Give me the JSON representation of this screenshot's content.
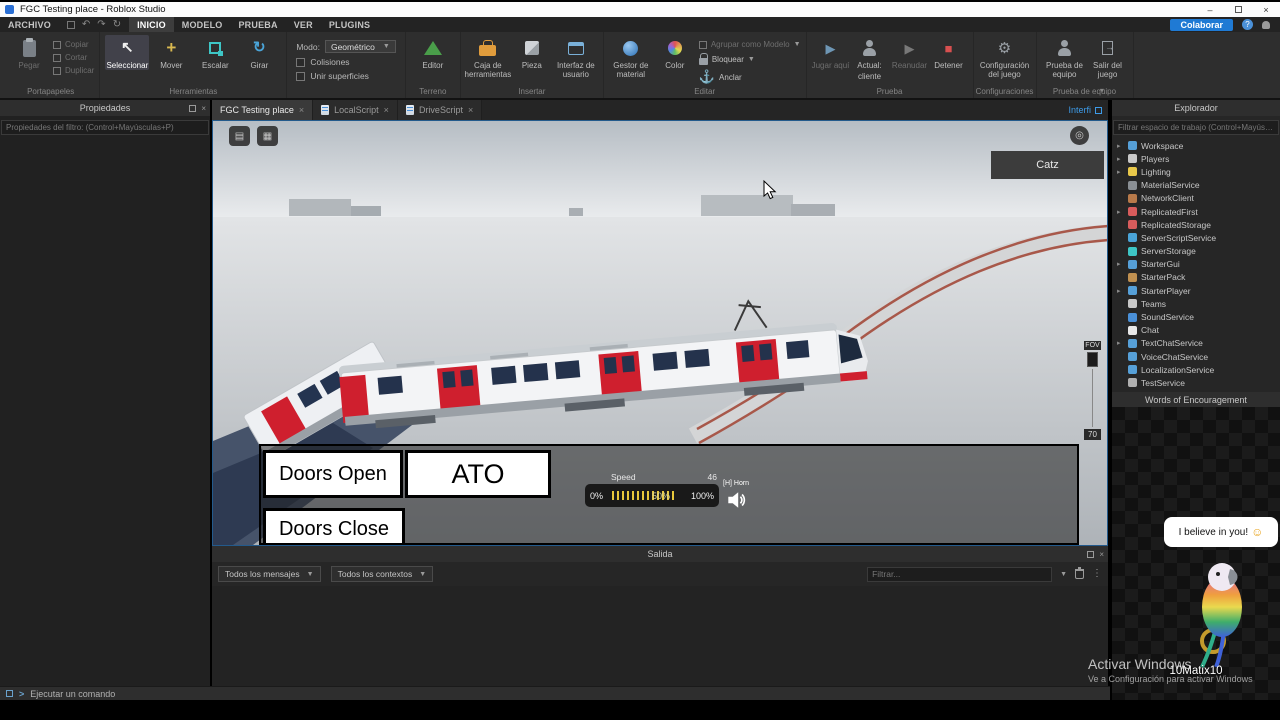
{
  "title_bar": {
    "title": "FGC Testing place - Roblox Studio",
    "minimize": "–",
    "close": "×"
  },
  "menu_bar": {
    "items": [
      "ARCHIVO",
      "INICIO",
      "MODELO",
      "PRUEBA",
      "VER",
      "PLUGINS"
    ],
    "active_item": "INICIO",
    "collaborate_label": "Colaborar",
    "help_glyph": "?"
  },
  "ribbon": {
    "clipboard": {
      "label": "Portapapeles",
      "paste": "Pegar",
      "copy": "Copiar",
      "cut": "Cortar",
      "duplicate": "Duplicar"
    },
    "tools": {
      "label": "Herramientas",
      "select": "Seleccionar",
      "move": "Mover",
      "scale": "Escalar",
      "rotate": "Girar",
      "mode_label": "Modo:",
      "mode_value": "Geométrico",
      "collisions": "Colisiones",
      "join_surfaces": "Unir superficies"
    },
    "terrain": {
      "label": "Terreno",
      "editor": "Editor"
    },
    "insert": {
      "label": "Insertar",
      "toolbox": "Caja de herramientas",
      "part": "Pieza",
      "ui": "Interfaz de usuario"
    },
    "edit": {
      "label": "Editar",
      "material_manager": "Gestor de material",
      "color": "Color",
      "group_model": "Agrupar como Modelo",
      "lock": "Bloquear",
      "anchor": "Anclar"
    },
    "test": {
      "label": "Prueba",
      "play_here": "Jugar aquí",
      "current_line1": "Actual:",
      "current_line2": "cliente",
      "resume": "Reanudar",
      "stop": "Detener"
    },
    "settings": {
      "label": "Configuraciones",
      "game_settings": "Configuración del juego"
    },
    "team_test": {
      "label": "Prueba de equipo",
      "team_test": "Prueba de equipo",
      "exit_game": "Salir del juego"
    }
  },
  "properties": {
    "title": "Propiedades",
    "filter_placeholder": "Propiedades del filtro: (Control+Mayúsculas+P)"
  },
  "tabs": {
    "items": [
      "FGC Testing place",
      "LocalScript",
      "DriveScript"
    ],
    "corner_link": "Interfi"
  },
  "viewport": {
    "catz_button": "Catz",
    "fov_label": "FOV",
    "fov_value": "70",
    "hud": {
      "doors_open": "Doors Open",
      "ato": "ATO",
      "doors_close": "Doors Close",
      "speed_label": "Speed",
      "speed_value": "46",
      "pct_0": "0%",
      "pct_50": "50%",
      "pct_100": "100%",
      "horn_label": "[H] Horn",
      "tick_color": "#e8c83c"
    }
  },
  "explorer": {
    "title": "Explorador",
    "filter_placeholder": "Filtrar espacio de trabajo (Control+Mayúsculas+X)",
    "items": [
      {
        "label": "Workspace",
        "color": "#56a0d8",
        "chevron": true
      },
      {
        "label": "Players",
        "color": "#c8c8c8",
        "chevron": true
      },
      {
        "label": "Lighting",
        "color": "#e8c84a",
        "chevron": true
      },
      {
        "label": "MaterialService",
        "color": "#8a8f94",
        "chevron": false
      },
      {
        "label": "NetworkClient",
        "color": "#b87a4a",
        "chevron": false
      },
      {
        "label": "ReplicatedFirst",
        "color": "#d85c5c",
        "chevron": true
      },
      {
        "label": "ReplicatedStorage",
        "color": "#d85c5c",
        "chevron": false
      },
      {
        "label": "ServerScriptService",
        "color": "#4aa4d8",
        "chevron": false
      },
      {
        "label": "ServerStorage",
        "color": "#3ec6c6",
        "chevron": false
      },
      {
        "label": "StarterGui",
        "color": "#56a0d8",
        "chevron": true
      },
      {
        "label": "StarterPack",
        "color": "#c09050",
        "chevron": false
      },
      {
        "label": "StarterPlayer",
        "color": "#56a0d8",
        "chevron": true
      },
      {
        "label": "Teams",
        "color": "#c8c8c8",
        "chevron": false
      },
      {
        "label": "SoundService",
        "color": "#4a90d8",
        "chevron": false
      },
      {
        "label": "Chat",
        "color": "#e8e8e8",
        "chevron": false
      },
      {
        "label": "TextChatService",
        "color": "#56a0d8",
        "chevron": true
      },
      {
        "label": "VoiceChatService",
        "color": "#56a0d8",
        "chevron": false
      },
      {
        "label": "LocalizationService",
        "color": "#56a0d8",
        "chevron": false
      },
      {
        "label": "TestService",
        "color": "#b0b0b0",
        "chevron": false
      }
    ]
  },
  "facecam": {
    "header": "Words of Encouragement",
    "speech_text": "I believe in you!",
    "speech_emoji": "☺",
    "username": "10Matix10"
  },
  "output": {
    "title": "Salida",
    "messages_filter": "Todos los mensajes",
    "context_filter": "Todos los contextos",
    "filter_placeholder": "Filtrar..."
  },
  "command_bar": {
    "placeholder": "Ejecutar un comando"
  },
  "watermark": {
    "line1": "Activar Windows",
    "line2": "Ve a Configuración para activar Windows"
  }
}
